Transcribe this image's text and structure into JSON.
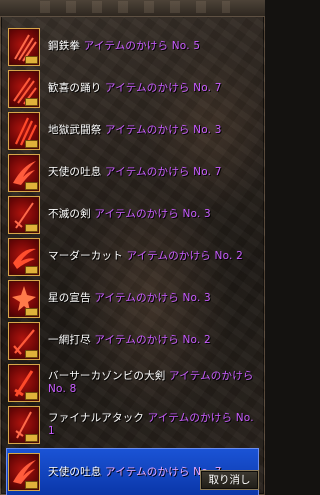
{
  "items": [
    {
      "name": "鋼鉄拳",
      "suffix": "アイテムのかけら No. 5",
      "icon": "crimson-claw-icon"
    },
    {
      "name": "歓喜の踊り",
      "suffix": "アイテムのかけら No. 7",
      "icon": "crimson-claw-icon"
    },
    {
      "name": "地獄武闘祭",
      "suffix": "アイテムのかけら No. 3",
      "icon": "crimson-claw-icon"
    },
    {
      "name": "天使の吐息",
      "suffix": "アイテムのかけら No. 7",
      "icon": "crimson-wing-icon"
    },
    {
      "name": "不滅の剣",
      "suffix": "アイテムのかけら No. 3",
      "icon": "crimson-sword-icon"
    },
    {
      "name": "マーダーカット",
      "suffix": "アイテムのかけら No. 2",
      "icon": "crimson-blade-icon"
    },
    {
      "name": "星の宣告",
      "suffix": "アイテムのかけら No. 3",
      "icon": "crimson-star-icon"
    },
    {
      "name": "一網打尽",
      "suffix": "アイテムのかけら No. 2",
      "icon": "crimson-sword-icon"
    },
    {
      "name": "バーサーカゾンビの大剣",
      "suffix": "アイテムのかけら No. 8",
      "icon": "crimson-sword-icon"
    },
    {
      "name": "ファイナルアタック",
      "suffix": "アイテムのかけら No. 1",
      "icon": "crimson-sword-icon"
    },
    {
      "name": "天使の吐息",
      "suffix": "アイテムのかけら No. 7",
      "icon": "crimson-wing-icon"
    }
  ],
  "cancel_label": "取り消し",
  "colors": {
    "item_name": "#ffffff",
    "item_suffix": "#c85cff",
    "selected_row": "#1446c8",
    "slot_border": "#d7a64a"
  }
}
